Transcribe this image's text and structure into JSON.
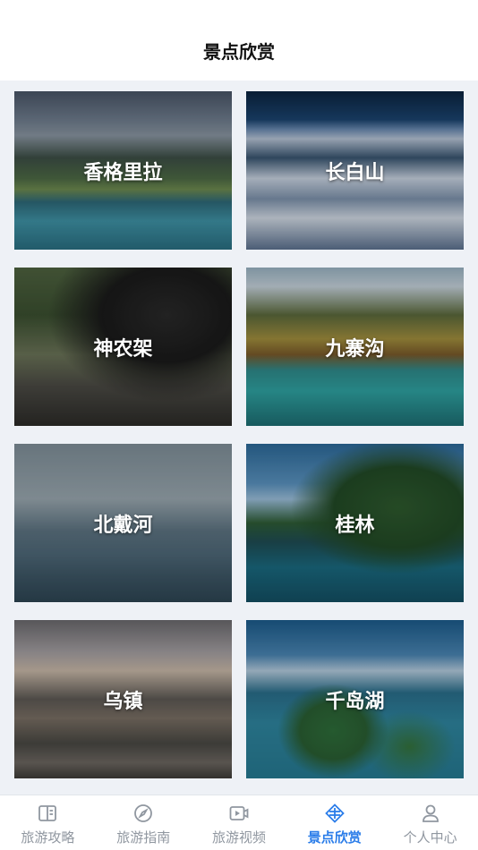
{
  "header": {
    "title": "景点欣赏"
  },
  "cards": [
    {
      "name": "香格里拉"
    },
    {
      "name": "长白山"
    },
    {
      "name": "神农架"
    },
    {
      "name": "九寨沟"
    },
    {
      "name": "北戴河"
    },
    {
      "name": "桂林"
    },
    {
      "name": "乌镇"
    },
    {
      "name": "千岛湖"
    }
  ],
  "tabbar": {
    "items": [
      {
        "label": "旅游攻略",
        "icon": "guide-book-icon"
      },
      {
        "label": "旅游指南",
        "icon": "compass-icon"
      },
      {
        "label": "旅游视频",
        "icon": "video-icon"
      },
      {
        "label": "景点欣赏",
        "icon": "scenic-icon",
        "active": true
      },
      {
        "label": "个人中心",
        "icon": "user-icon"
      }
    ],
    "active_color": "#2b7de9",
    "inactive_color": "#9097a0"
  }
}
